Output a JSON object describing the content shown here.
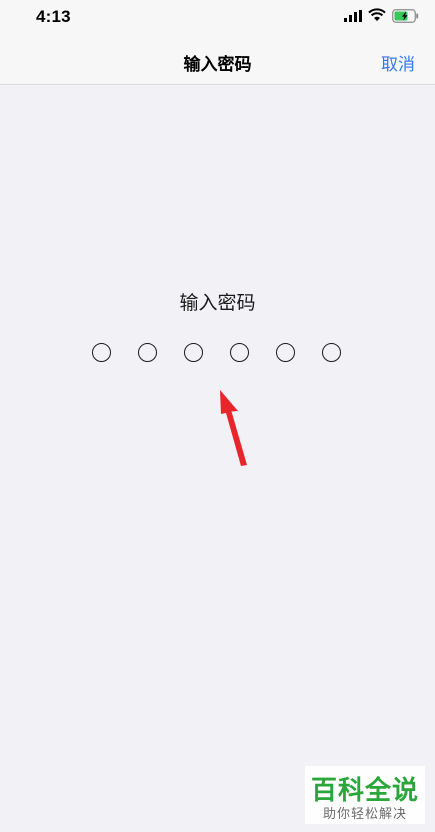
{
  "status_bar": {
    "time": "4:13",
    "icons": [
      "cellular-signal-icon",
      "wifi-icon",
      "battery-charging-icon"
    ],
    "battery_color": "#3bc55a"
  },
  "nav": {
    "title": "输入密码",
    "cancel_label": "取消",
    "accent_color": "#3478f6"
  },
  "passcode": {
    "prompt": "输入密码",
    "digit_count": 6,
    "digits_entered": 0
  },
  "annotation": {
    "arrow_color": "#e8252b"
  },
  "watermark": {
    "title": "百科全说",
    "subtitle": "助你轻松解决",
    "color": "#2aa63a"
  }
}
